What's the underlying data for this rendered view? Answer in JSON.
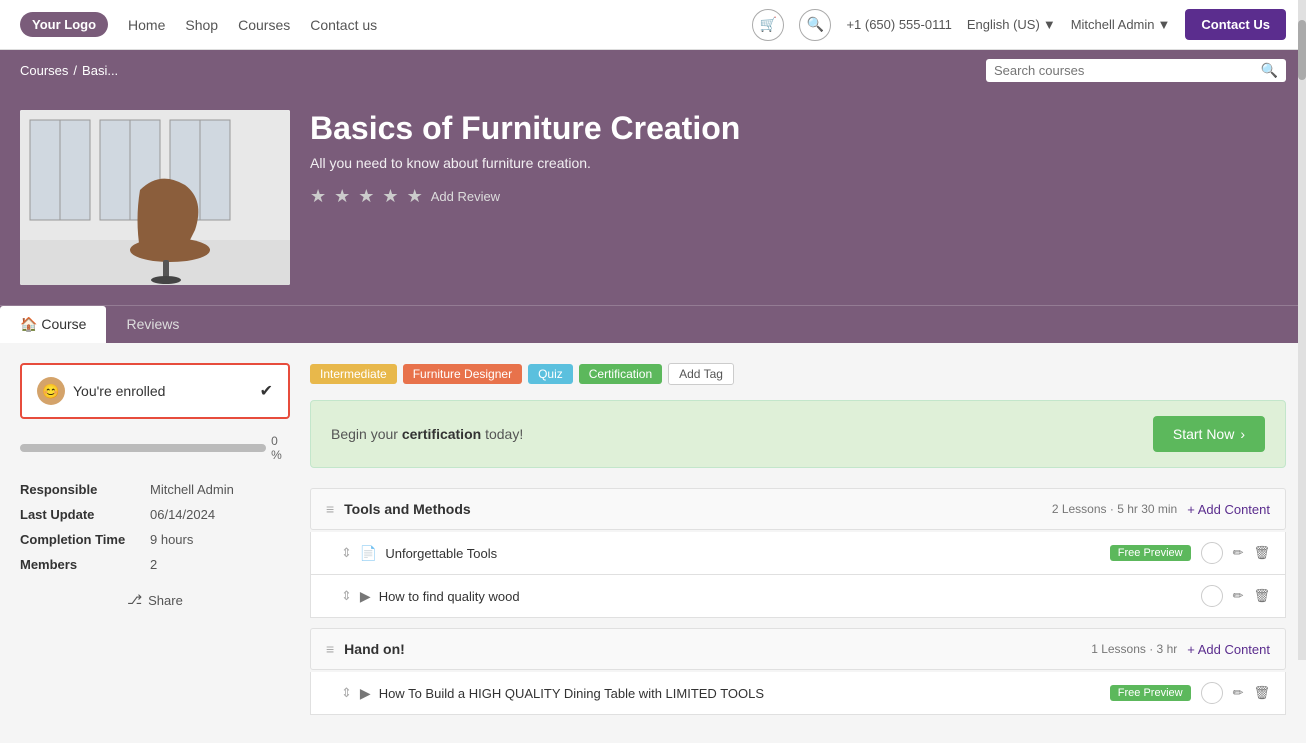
{
  "logo": "Your Logo",
  "nav": {
    "home": "Home",
    "shop": "Shop",
    "courses": "Courses",
    "contact": "Contact us"
  },
  "phone": "+1 (650) 555-0111",
  "language": "English (US)",
  "admin": "Mitchell Admin",
  "contact_us_btn": "Contact Us",
  "breadcrumb": {
    "courses": "Courses",
    "separator": "/",
    "current": "Basi..."
  },
  "search_placeholder": "Search courses",
  "course": {
    "title": "Basics of Furniture Creation",
    "subtitle": "All you need to know about furniture creation.",
    "add_review": "Add Review",
    "tab_course": "Course",
    "tab_reviews": "Reviews"
  },
  "sidebar": {
    "enrolled_text": "You're enrolled",
    "progress_pct": "0 %",
    "responsible_label": "Responsible",
    "responsible_value": "Mitchell Admin",
    "last_update_label": "Last Update",
    "last_update_value": "06/14/2024",
    "completion_label": "Completion Time",
    "completion_value": "9 hours",
    "members_label": "Members",
    "members_value": "2",
    "share": "Share"
  },
  "tags": [
    {
      "label": "Intermediate",
      "class": "tag-intermediate"
    },
    {
      "label": "Furniture Designer",
      "class": "tag-furniture"
    },
    {
      "label": "Quiz",
      "class": "tag-quiz"
    },
    {
      "label": "Certification",
      "class": "tag-certification"
    }
  ],
  "add_tag": "Add Tag",
  "certification_banner": {
    "text_before": "Begin your ",
    "text_bold": "certification",
    "text_after": " today!",
    "button": "Start Now"
  },
  "sections": [
    {
      "title": "Tools and Methods",
      "lessons_info": "2 Lessons · 5 hr 30 min",
      "add_content": "+ Add Content",
      "lessons": [
        {
          "title": "Unforgettable Tools",
          "type": "file",
          "free_preview": true
        },
        {
          "title": "How to find quality wood",
          "type": "video",
          "free_preview": false
        }
      ]
    },
    {
      "title": "Hand on!",
      "lessons_info": "1 Lessons · 3 hr",
      "add_content": "+ Add Content",
      "lessons": [
        {
          "title": "How To Build a HIGH QUALITY Dining Table with LIMITED TOOLS",
          "type": "video",
          "free_preview": true
        }
      ]
    }
  ]
}
